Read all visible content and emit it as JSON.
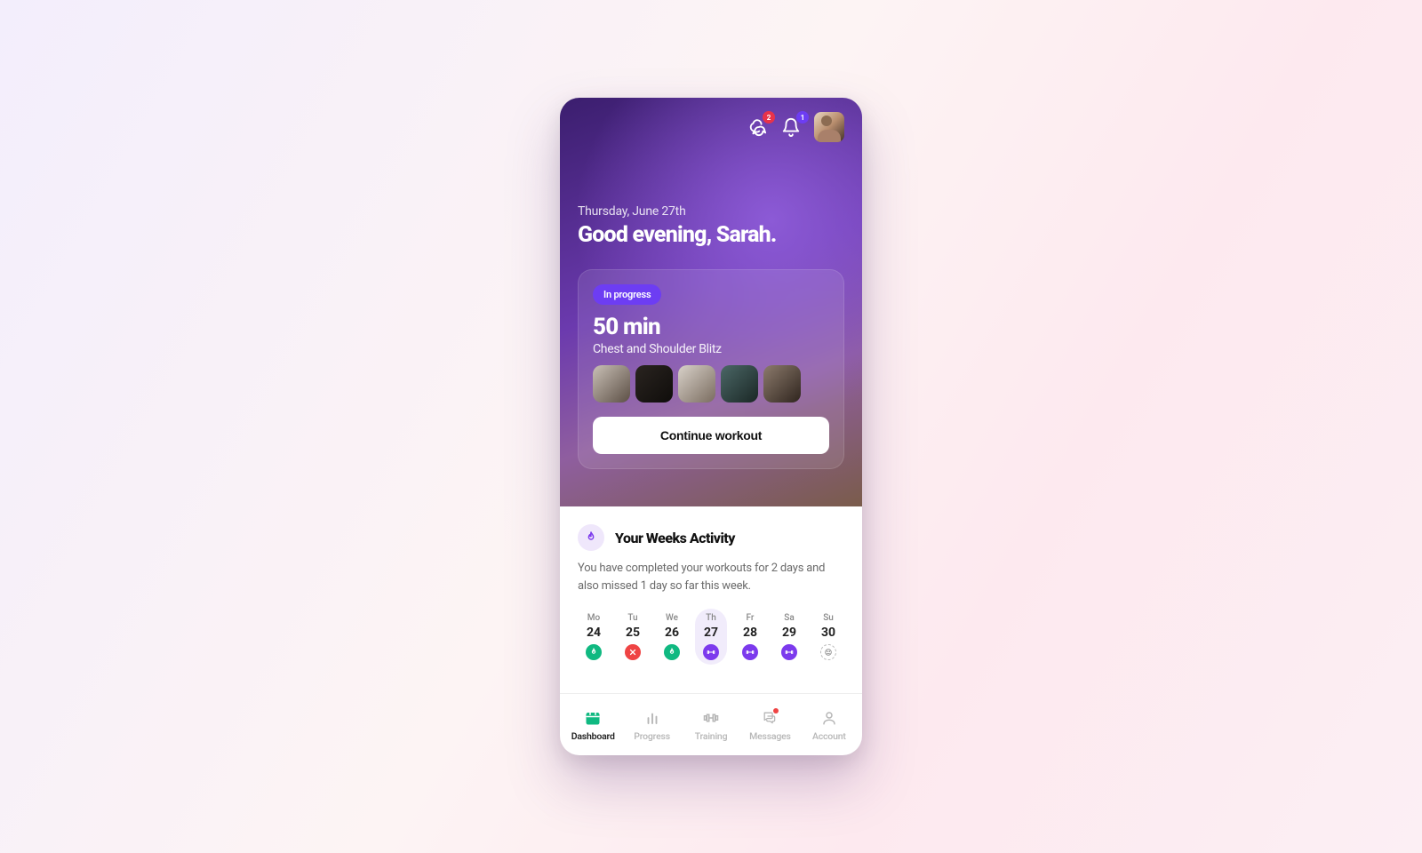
{
  "header": {
    "chat_badge": "2",
    "bell_badge": "1"
  },
  "greeting": {
    "date": "Thursday, June 27th",
    "hello": "Good evening, Sarah."
  },
  "workout_card": {
    "status": "In progress",
    "duration": "50 min",
    "name": "Chest and Shoulder Blitz",
    "cta": "Continue workout"
  },
  "activity": {
    "title": "Your Weeks Activity",
    "desc": "You have completed your workouts for 2 days and also missed 1 day so far this week.",
    "days": [
      {
        "short": "Mo",
        "num": "24",
        "status": "done"
      },
      {
        "short": "Tu",
        "num": "25",
        "status": "missed"
      },
      {
        "short": "We",
        "num": "26",
        "status": "done"
      },
      {
        "short": "Th",
        "num": "27",
        "status": "plan",
        "selected": true
      },
      {
        "short": "Fr",
        "num": "28",
        "status": "plan"
      },
      {
        "short": "Sa",
        "num": "29",
        "status": "plan"
      },
      {
        "short": "Su",
        "num": "30",
        "status": "rest"
      }
    ]
  },
  "tabs": {
    "dashboard": "Dashboard",
    "progress": "Progress",
    "training": "Training",
    "messages": "Messages",
    "account": "Account"
  }
}
